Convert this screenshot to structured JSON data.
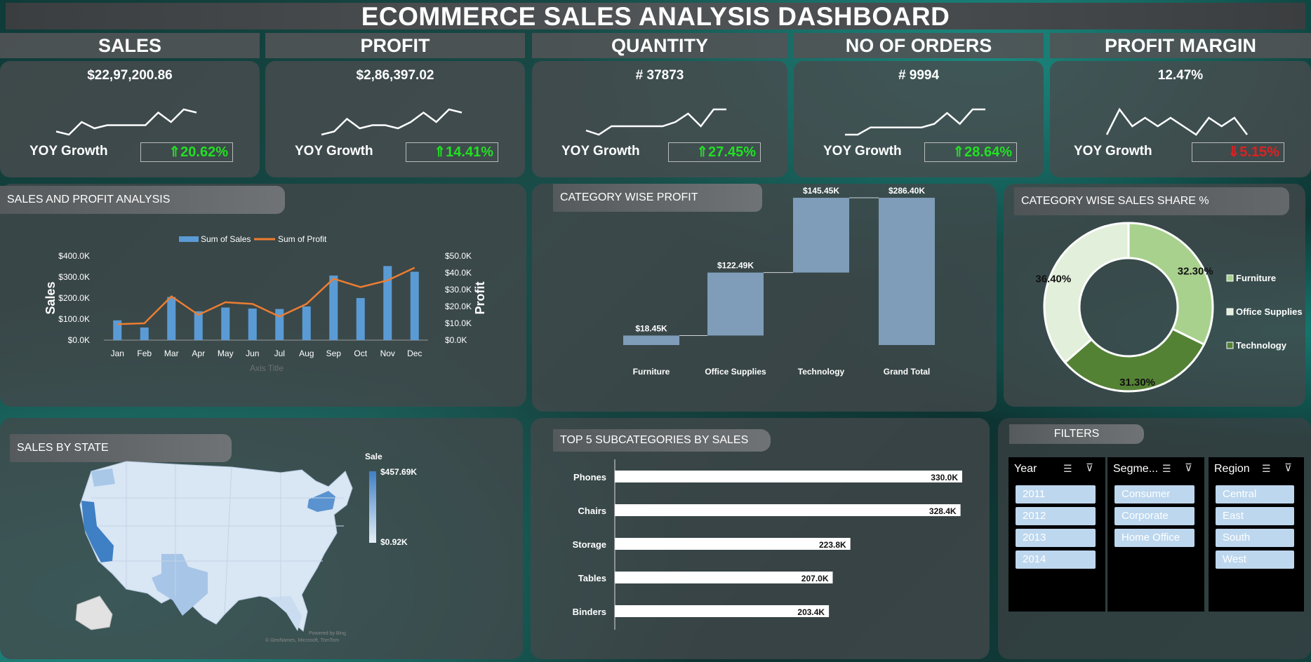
{
  "title": "ECOMMERCE SALES ANALYSIS DASHBOARD",
  "colors": {
    "positive": "#22e022",
    "negative": "#e02020",
    "bar": "#5b9bd5",
    "profit_line": "#ed7d31",
    "waterfall": "#7f9db9",
    "donut_furniture": "#a9d18e",
    "donut_office": "#e2efda",
    "donut_tech": "#548235"
  },
  "kpis": [
    {
      "label": "SALES",
      "value": "$22,97,200.86",
      "yoy_label": "YOY Growth",
      "yoy": "⇑20.62%",
      "yoy_dir": "up",
      "trend": [
        3,
        2,
        6,
        4,
        5,
        5,
        5,
        5,
        9,
        6,
        10,
        9
      ]
    },
    {
      "label": "PROFIT",
      "value": "$2,86,397.02",
      "yoy_label": "YOY Growth",
      "yoy": "⇑14.41%",
      "yoy_dir": "up",
      "trend": [
        2,
        3,
        7,
        4,
        5,
        5,
        4,
        6,
        9,
        6,
        10,
        9
      ]
    },
    {
      "label": "QUANTITY",
      "value": "# 37873",
      "yoy_label": "YOY Growth",
      "yoy": "⇑27.45%",
      "yoy_dir": "up",
      "trend": [
        4,
        3,
        5,
        5,
        5,
        5,
        5,
        6,
        8,
        5,
        9,
        9
      ]
    },
    {
      "label": "NO OF ORDERS",
      "value": "# 9994",
      "yoy_label": "YOY Growth",
      "yoy": "⇑28.64%",
      "yoy_dir": "up",
      "trend": [
        3,
        3,
        5,
        5,
        5,
        5,
        5,
        6,
        9,
        6,
        10,
        10
      ]
    },
    {
      "label": "PROFIT MARGIN",
      "value": "12.47%",
      "yoy_label": "YOY Growth",
      "yoy": "⇓5.15%",
      "yoy_dir": "down",
      "trend": [
        4,
        7,
        5,
        6,
        5,
        6,
        5,
        4,
        6,
        5,
        6,
        4
      ]
    }
  ],
  "sections": {
    "sales_profit": "SALES AND PROFIT ANALYSIS",
    "category_profit": "CATEGORY WISE PROFIT",
    "category_share": "CATEGORY WISE SALES SHARE %",
    "sales_by_state": "SALES BY STATE",
    "top5": "TOP 5 SUBCATEGORIES BY SALES",
    "filters": "FILTERS"
  },
  "chart_data": [
    {
      "type": "bar",
      "title": "SALES AND PROFIT ANALYSIS",
      "categories": [
        "Jan",
        "Feb",
        "Mar",
        "Apr",
        "May",
        "Jun",
        "Jul",
        "Aug",
        "Sep",
        "Oct",
        "Nov",
        "Dec"
      ],
      "series": [
        {
          "name": "Sum of Sales",
          "type": "bar",
          "axis": "left",
          "values": [
            94,
            60,
            205,
            137,
            155,
            150,
            148,
            160,
            307,
            200,
            352,
            325
          ]
        },
        {
          "name": "Sum of Profit",
          "type": "line",
          "axis": "right",
          "values": [
            9.5,
            10,
            26,
            15,
            22.5,
            21.5,
            14,
            21.5,
            36.5,
            31.5,
            35.5,
            43
          ]
        }
      ],
      "ylabel": "Sales",
      "y2label": "Profit",
      "xlabel": "Axis Title",
      "ylim": [
        0,
        400
      ],
      "y2lim": [
        0,
        50
      ],
      "yticks": [
        "$0.0K",
        "$100.0K",
        "$200.0K",
        "$300.0K",
        "$400.0K"
      ],
      "y2ticks": [
        "$0.0K",
        "$10.0K",
        "$20.0K",
        "$30.0K",
        "$40.0K",
        "$50.0K"
      ],
      "legend": "top"
    },
    {
      "type": "bar",
      "subtype": "waterfall",
      "title": "CATEGORY WISE PROFIT",
      "categories": [
        "Furniture",
        "Office Supplies",
        "Technology",
        "Grand Total"
      ],
      "values": [
        18.45,
        122.49,
        145.45,
        286.4
      ],
      "labels": [
        "$18.45K",
        "$122.49K",
        "$145.45K",
        "$286.40K"
      ]
    },
    {
      "type": "pie",
      "subtype": "donut",
      "title": "CATEGORY WISE SALES SHARE %",
      "categories": [
        "Furniture",
        "Office Supplies",
        "Technology"
      ],
      "values": [
        32.3,
        36.4,
        31.3
      ],
      "labels": [
        "32.30%",
        "36.40%",
        "31.30%"
      ],
      "legend": "right"
    },
    {
      "type": "bar",
      "orientation": "horizontal",
      "title": "TOP 5 SUBCATEGORIES BY SALES",
      "categories": [
        "Phones",
        "Chairs",
        "Storage",
        "Tables",
        "Binders"
      ],
      "values": [
        330.0,
        328.4,
        223.8,
        207.0,
        203.4
      ],
      "labels": [
        "330.0K",
        "328.4K",
        "223.8K",
        "207.0K",
        "203.4K"
      ]
    }
  ],
  "map": {
    "legend_title": "Sale",
    "max_label": "$457.69K",
    "min_label": "$0.92K",
    "credit_1": "Powered by Bing",
    "credit_2": "© GeoNames, Microsoft, TomTom"
  },
  "slicers": [
    {
      "title": "Year",
      "items": [
        "2011",
        "2012",
        "2013",
        "2014"
      ]
    },
    {
      "title": "Segme...",
      "items": [
        "Consumer",
        "Corporate",
        "Home Office"
      ]
    },
    {
      "title": "Region",
      "items": [
        "Central",
        "East",
        "South",
        "West"
      ]
    }
  ]
}
